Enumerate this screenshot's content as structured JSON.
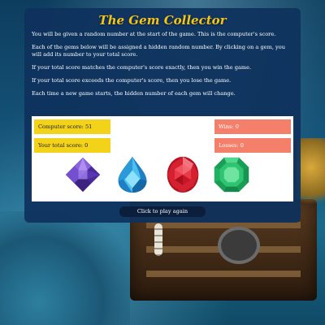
{
  "title": "The Gem Collector",
  "rules": [
    "You will be given a random number at the start of the game. This is the computer's score.",
    "Each of the gems below will be assigned a hidden random number. By clicking on a gem, you will add its number to your total score.",
    "If your total score matches the computer's score exactly, then you win the game.",
    "If your total score exceeds the computer's score, then you lose the game.",
    "Each time a new game starts, the hidden number of each gem will change."
  ],
  "scores": {
    "computer": "Computer score: 51",
    "total": "Your total score: 0",
    "wins": "Wins: 0",
    "losses": "Losses: 0"
  },
  "gems": [
    {
      "name": "purple-gem-icon",
      "color": "#6a3cc4"
    },
    {
      "name": "blue-gem-icon",
      "color": "#2aa6e0"
    },
    {
      "name": "red-gem-icon",
      "color": "#d51f2a"
    },
    {
      "name": "green-gem-icon",
      "color": "#2bbf6a"
    }
  ],
  "play_button": "Click to play again",
  "colors": {
    "title": "#f4c518",
    "panel": "#0e315c",
    "score_yellow": "#f3d21a",
    "score_coral": "#f47f6b",
    "button": "#0b1f3d"
  }
}
